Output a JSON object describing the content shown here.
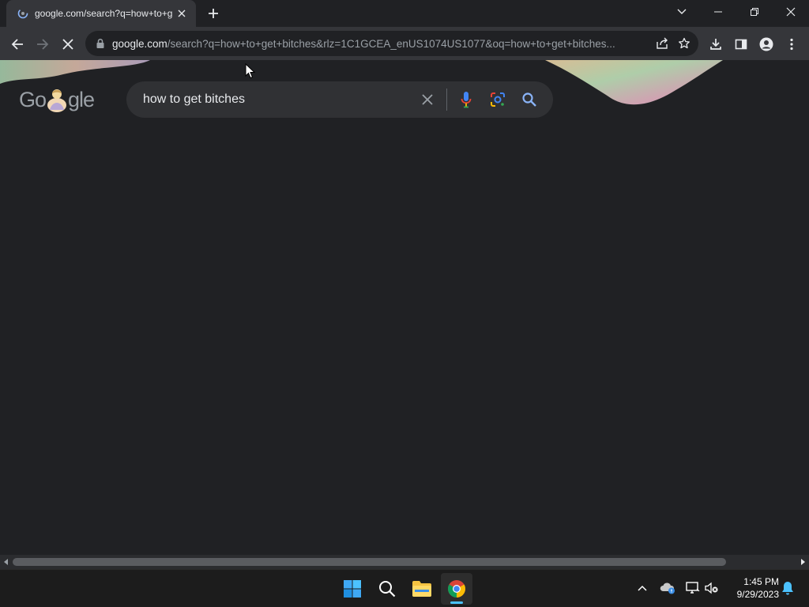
{
  "browser": {
    "tab": {
      "title": "google.com/search?q=how+to+get+bitches"
    },
    "address_bar": {
      "host": "google.com",
      "path": "/search?q=how+to+get+bitches&rlz=1C1GCEA_enUS1074US1077&oq=how+to+get+bitches..."
    }
  },
  "page": {
    "logo_text": {
      "part1": "Go",
      "part2": "gle"
    },
    "search": {
      "query": "how to get bitches"
    }
  },
  "taskbar": {
    "time": "1:45 PM",
    "date": "9/29/2023"
  },
  "colors": {
    "tab_active": "#35363a",
    "toolbar": "#35363a",
    "page_bg": "#202124",
    "search_box": "#303134",
    "accent_blue": "#8ab4f8"
  }
}
